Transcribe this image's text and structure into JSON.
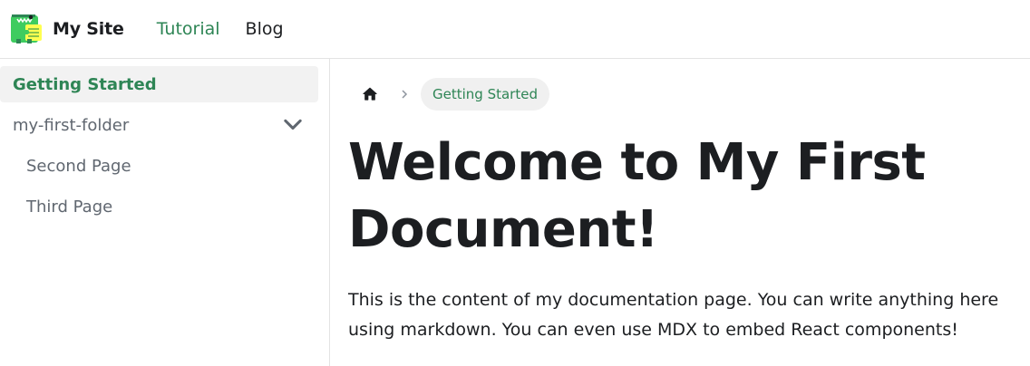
{
  "navbar": {
    "brand_title": "My Site",
    "links": [
      {
        "label": "Tutorial",
        "active": true
      },
      {
        "label": "Blog",
        "active": false
      }
    ]
  },
  "sidebar": {
    "items": [
      {
        "label": "Getting Started",
        "active": true
      },
      {
        "label": "my-first-folder",
        "expanded": true
      },
      {
        "label": "Second Page"
      },
      {
        "label": "Third Page"
      }
    ]
  },
  "breadcrumb": {
    "current": "Getting Started"
  },
  "content": {
    "title": "Welcome to My First Document!",
    "body": "This is the content of my documentation page. You can write anything here using markdown. You can even use MDX to embed React components!"
  },
  "colors": {
    "accent": "#2e8555",
    "text": "#1c1e21",
    "muted": "#606770",
    "active_bg": "#f2f2f2"
  }
}
